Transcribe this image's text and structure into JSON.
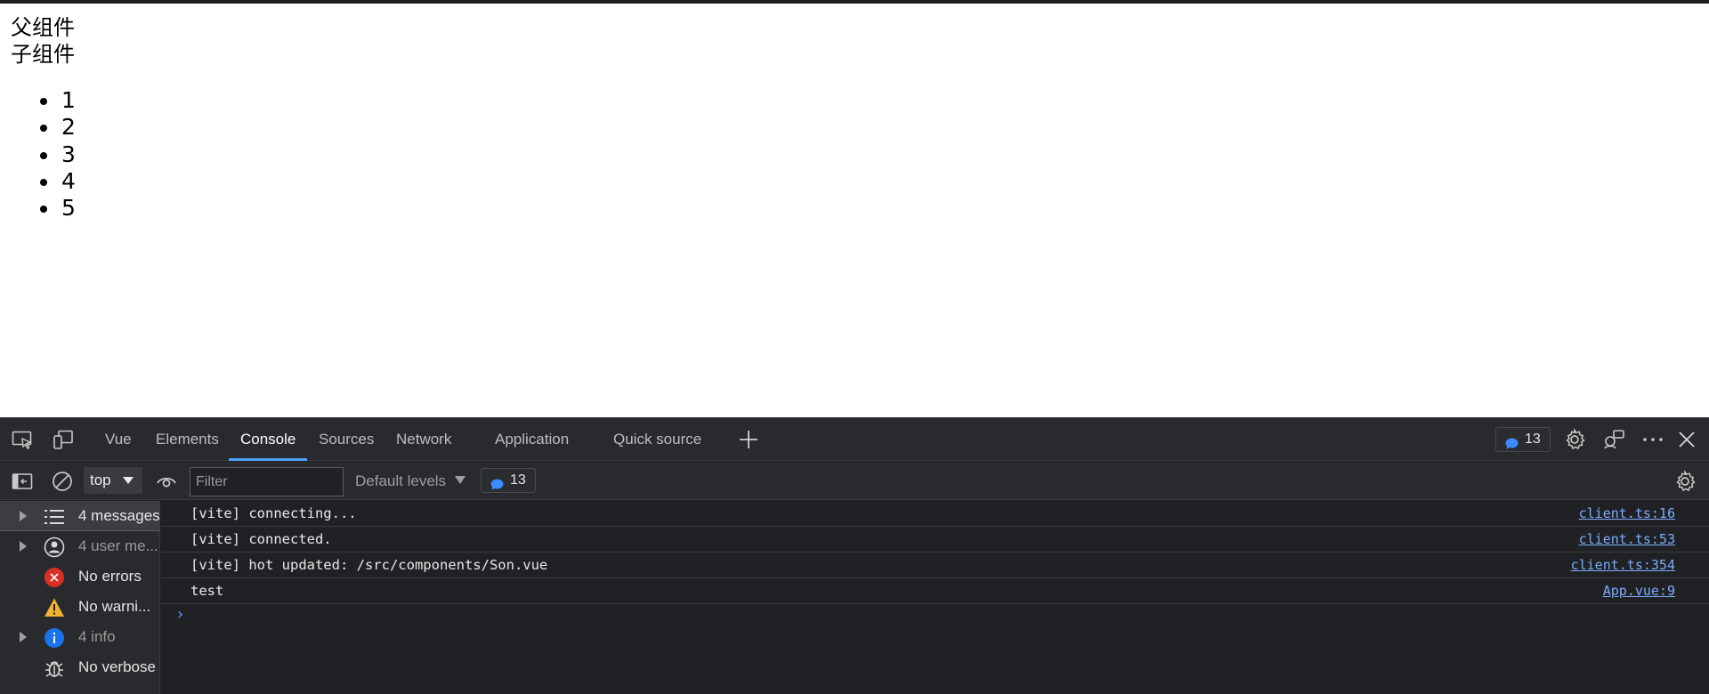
{
  "page": {
    "parent_label": "父组件",
    "child_label": "子组件",
    "list_items": [
      "1",
      "2",
      "3",
      "4",
      "5"
    ]
  },
  "devtools": {
    "tabs": [
      "Vue",
      "Elements",
      "Console",
      "Sources",
      "Network",
      "Application",
      "Quick source"
    ],
    "active_tab": "Console",
    "message_count": "13",
    "toolbar": {
      "context": "top",
      "filter_placeholder": "Filter",
      "levels": "Default levels",
      "badge_count": "13"
    },
    "sidebar": [
      {
        "label": "4 messages",
        "icon": "list-icon",
        "expandable": true,
        "selected": true
      },
      {
        "label": "4 user me...",
        "icon": "user-icon",
        "expandable": true,
        "selected": false
      },
      {
        "label": "No errors",
        "icon": "error-icon",
        "expandable": false,
        "selected": false
      },
      {
        "label": "No warni...",
        "icon": "warning-icon",
        "expandable": false,
        "selected": false
      },
      {
        "label": "4 info",
        "icon": "info-icon",
        "expandable": true,
        "selected": false
      },
      {
        "label": "No verbose",
        "icon": "bug-icon",
        "expandable": false,
        "selected": false
      }
    ],
    "messages": [
      {
        "text": "[vite] connecting...",
        "source": "client.ts:16"
      },
      {
        "text": "[vite] connected.",
        "source": "client.ts:53"
      },
      {
        "text": "[vite] hot updated: /src/components/Son.vue",
        "source": "client.ts:354"
      },
      {
        "text": "test",
        "source": "App.vue:9"
      }
    ],
    "prompt_glyph": "›"
  },
  "colors": {
    "devtools_bg": "#202124",
    "panel_bg": "#292a2d",
    "accent": "#4aa3ff",
    "link": "#7cacf8",
    "error": "#e0352b",
    "warning": "#f2b233",
    "info": "#1a73e8"
  }
}
